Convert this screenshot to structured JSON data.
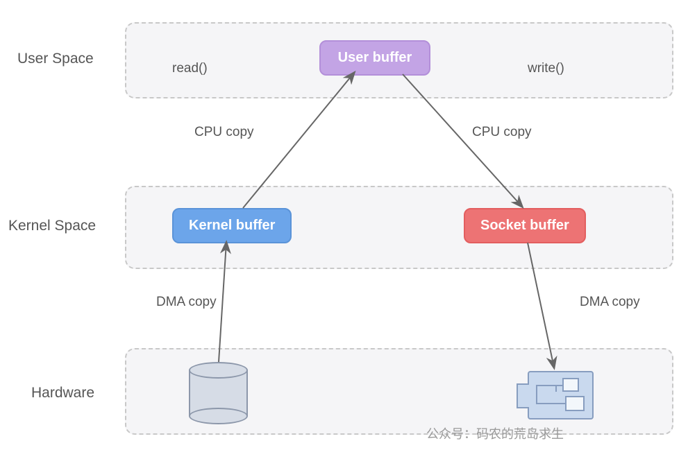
{
  "layers": {
    "user": "User Space",
    "kernel": "Kernel Space",
    "hardware": "Hardware"
  },
  "buffers": {
    "user": "User buffer",
    "kernel": "Kernel buffer",
    "socket": "Socket buffer"
  },
  "calls": {
    "read": "read()",
    "write": "write()"
  },
  "copies": {
    "cpu_up": "CPU copy",
    "cpu_down": "CPU copy",
    "dma_up": "DMA copy",
    "dma_down": "DMA copy"
  },
  "watermark": "公众号：码农的荒岛求生"
}
